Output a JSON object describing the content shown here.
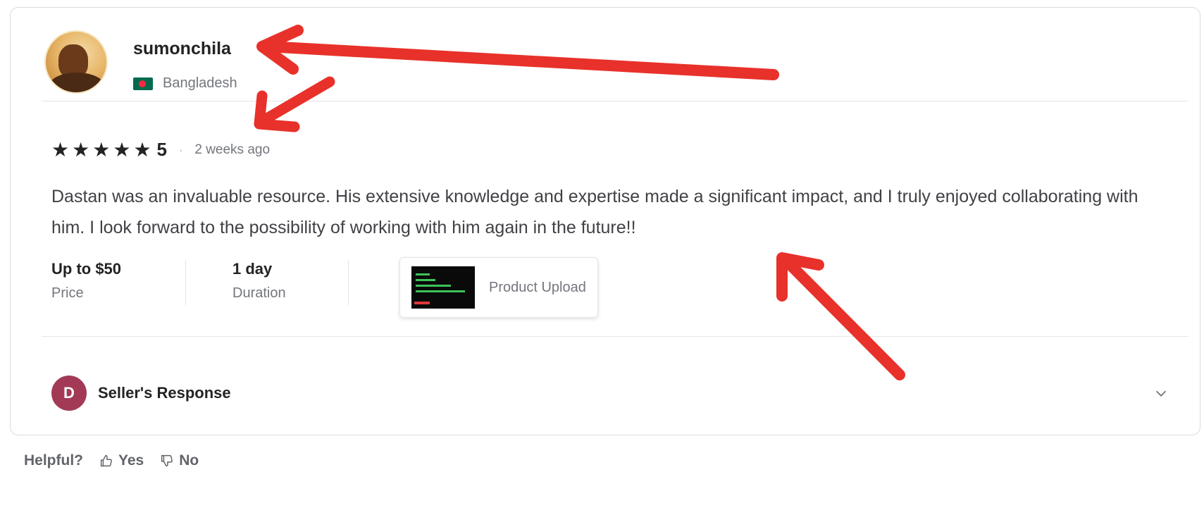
{
  "reviewer": {
    "username": "sumonchila",
    "country": "Bangladesh"
  },
  "rating": {
    "stars": 5,
    "score": "5",
    "separator": "·",
    "time_ago": "2 weeks ago"
  },
  "review_text": "Dastan was an invaluable resource. His extensive knowledge and expertise made a significant impact, and I truly enjoyed collaborating with him. I look forward to the possibility of working with him again in the future!!",
  "meta": {
    "price_value": "Up to $50",
    "price_label": "Price",
    "duration_value": "1 day",
    "duration_label": "Duration",
    "product_name": "Product Upload"
  },
  "seller_response": {
    "avatar_letter": "D",
    "label": "Seller's Response"
  },
  "helpful": {
    "question": "Helpful?",
    "yes": "Yes",
    "no": "No"
  },
  "colors": {
    "annotation_arrow": "#e8312a",
    "seller_avatar": "#a23a56"
  }
}
